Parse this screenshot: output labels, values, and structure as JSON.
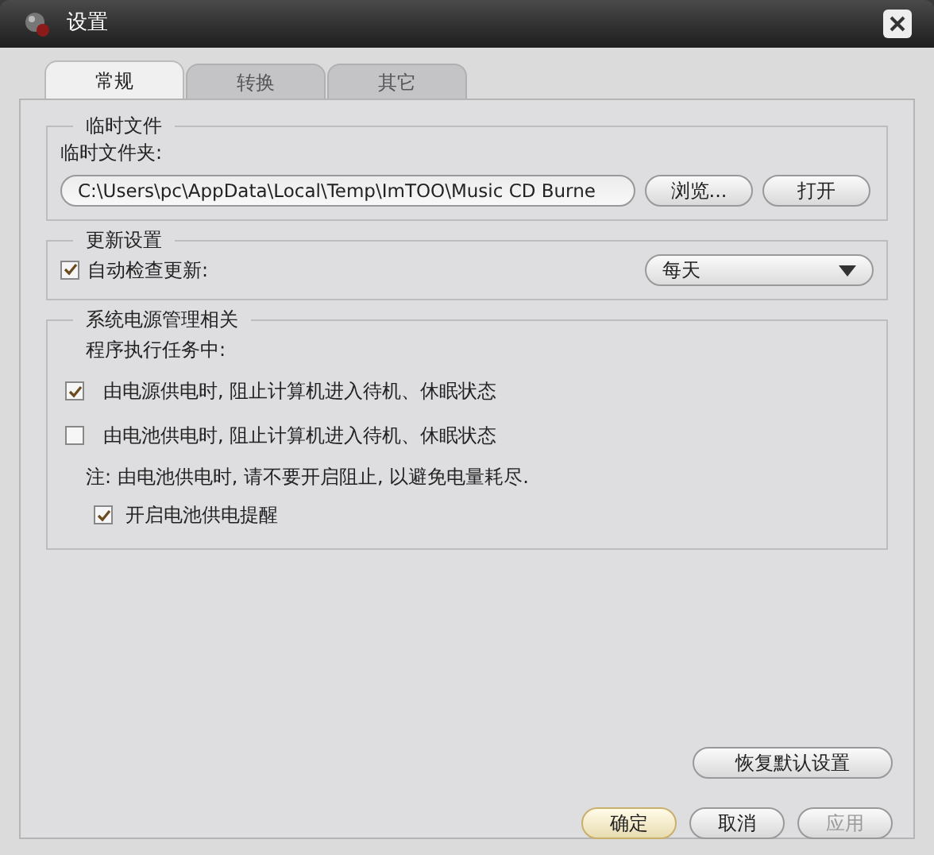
{
  "window": {
    "title": "设置"
  },
  "tabs": [
    {
      "label": "常规",
      "selected": true
    },
    {
      "label": "转换",
      "selected": false
    },
    {
      "label": "其它",
      "selected": false
    }
  ],
  "temp_files": {
    "title": "临时文件",
    "folder_label": "临时文件夹:",
    "folder_path": "C:\\Users\\pc\\AppData\\Local\\Temp\\ImTOO\\Music CD Burne",
    "browse_button": "浏览...",
    "open_button": "打开"
  },
  "updates": {
    "title": "更新设置",
    "auto_check": {
      "label": "自动检查更新:",
      "checked": true
    },
    "frequency": "每天"
  },
  "power": {
    "title": "系统电源管理相关",
    "subtitle": "程序执行任务中:",
    "options": [
      {
        "label": "由电源供电时, 阻止计算机进入待机、休眠状态",
        "checked": true
      },
      {
        "label": "由电池供电时, 阻止计算机进入待机、休眠状态",
        "checked": false
      }
    ],
    "note": "注: 由电池供电时, 请不要开启阻止, 以避免电量耗尽.",
    "reminder": {
      "label": "开启电池供电提醒",
      "checked": true
    }
  },
  "restore_button": "恢复默认设置",
  "buttons": [
    {
      "label": "确定",
      "kind": "default",
      "disabled": false
    },
    {
      "label": "取消",
      "kind": "normal",
      "disabled": false
    },
    {
      "label": "应用",
      "kind": "normal",
      "disabled": true
    }
  ]
}
